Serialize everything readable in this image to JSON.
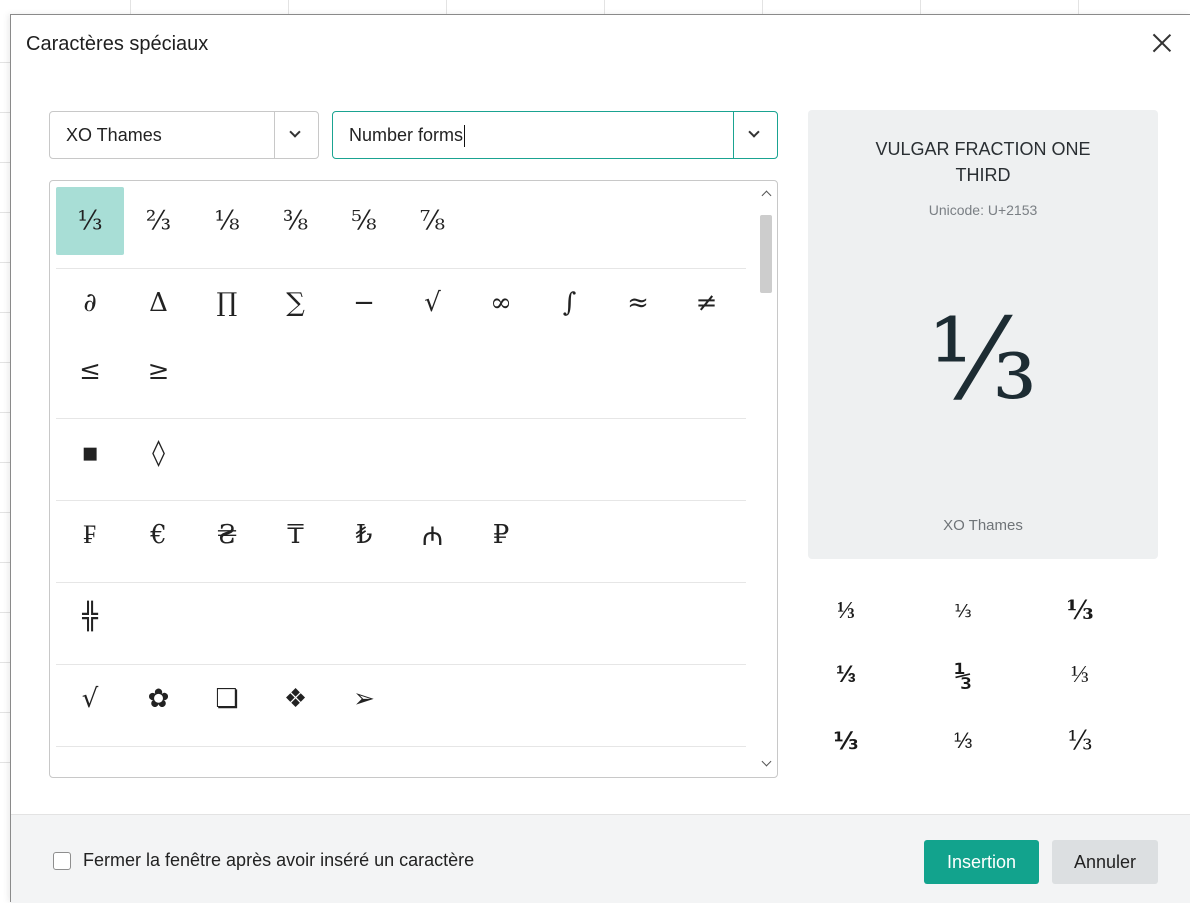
{
  "dialog": {
    "title": "Caractères spéciaux"
  },
  "font_select": {
    "value": "XO Thames"
  },
  "range_select": {
    "value": "Number forms"
  },
  "groups": [
    {
      "symbols": [
        "⅓",
        "⅔",
        "⅛",
        "⅜",
        "⅝",
        "⅞"
      ],
      "selected_index": 0
    },
    {
      "symbols": [
        "∂",
        "Δ",
        "∏",
        "∑",
        "−",
        "√",
        "∞",
        "∫",
        "≈",
        "≠",
        "≤",
        "≥"
      ]
    },
    {
      "symbols": [
        "▪",
        "◊"
      ]
    },
    {
      "symbols": [
        "₣",
        "€",
        "₴",
        "₸",
        "₺",
        "₼",
        "₽"
      ]
    },
    {
      "symbols": [
        "╬"
      ]
    },
    {
      "symbols": [
        "√",
        "✿",
        "❏",
        "❖",
        "➢"
      ]
    }
  ],
  "preview": {
    "name": "VULGAR FRACTION ONE THIRD",
    "code": "Unicode: U+2153",
    "glyph": "⅓",
    "font": "XO Thames"
  },
  "variants": [
    "⅓",
    "⅓",
    "⅓",
    "⅓",
    "⅓",
    "⅓",
    "⅓",
    "⅓",
    "⅓"
  ],
  "footer": {
    "checkbox_label": "Fermer la fenêtre après avoir inséré un caractère",
    "checkbox_checked": false,
    "insert_label": "Insertion",
    "cancel_label": "Annuler"
  }
}
